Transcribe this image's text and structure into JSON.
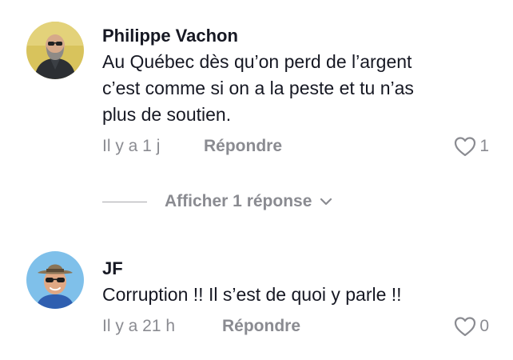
{
  "comments": [
    {
      "author": "Philippe Vachon",
      "text_lines": [
        "Au Québec dès qu’on perd de l’argent",
        "c’est comme si on a la peste et tu n’as",
        "plus de soutien."
      ],
      "time": "Il y a 1 j",
      "reply_label": "Répondre",
      "like_count": "1",
      "avatar_icon": "bearded-man-avatar",
      "avatar_bg": "#d9c25a"
    },
    {
      "author": "JF",
      "text_lines": [
        "Corruption !! Il s’est de quoi y parle !!"
      ],
      "time": "Il y a 21 h",
      "reply_label": "Répondre",
      "like_count": "0",
      "avatar_icon": "man-with-hat-sunglasses-avatar",
      "avatar_bg": "#7fc0ea"
    }
  ],
  "view_replies": {
    "label": "Afficher 1 réponse",
    "icon": "chevron-down-icon"
  },
  "colors": {
    "primary_text": "#161823",
    "secondary_text": "#8a8b91"
  }
}
